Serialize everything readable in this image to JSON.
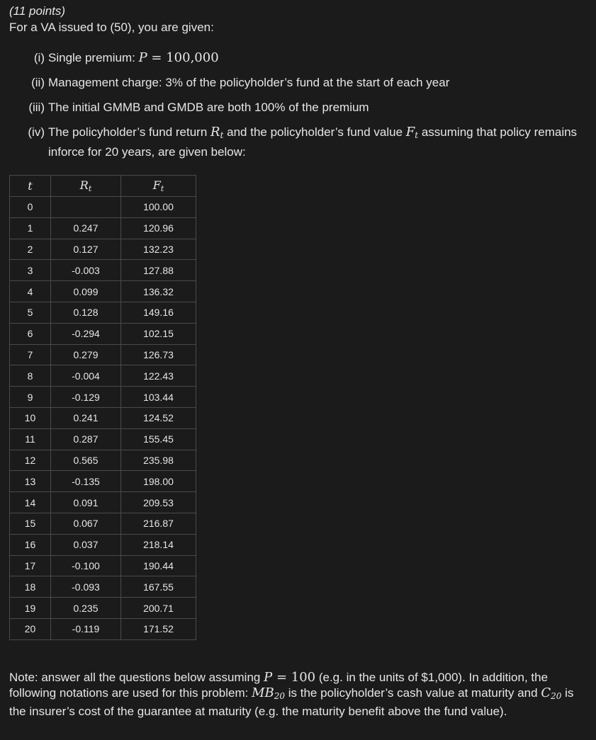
{
  "header": {
    "points": "(11 points)",
    "intro": "For a VA issued to (50), you are given:"
  },
  "givens": [
    {
      "num": "(i)",
      "text": "Single premium: ",
      "math_var": "P",
      "math_rest": " = 100,000"
    },
    {
      "num": "(ii)",
      "text": "Management charge: 3% of the policyholder’s fund at the start of each year"
    },
    {
      "num": "(iii)",
      "text": "The initial GMMB and GMDB are both 100% of the premium"
    },
    {
      "num": "(iv)",
      "text_a": "The policyholder’s fund return ",
      "var_a": "R",
      "sub_a": "t",
      "text_b": " and the policyholder’s fund value ",
      "var_b": "F",
      "sub_b": "t",
      "text_c": " assuming that policy remains inforce for 20 years, are given below:"
    }
  ],
  "table": {
    "headers": [
      {
        "var": "t",
        "sub": ""
      },
      {
        "var": "R",
        "sub": "t"
      },
      {
        "var": "F",
        "sub": "t"
      }
    ],
    "rows": [
      [
        "0",
        "",
        "100.00"
      ],
      [
        "1",
        "0.247",
        "120.96"
      ],
      [
        "2",
        "0.127",
        "132.23"
      ],
      [
        "3",
        "-0.003",
        "127.88"
      ],
      [
        "4",
        "0.099",
        "136.32"
      ],
      [
        "5",
        "0.128",
        "149.16"
      ],
      [
        "6",
        "-0.294",
        "102.15"
      ],
      [
        "7",
        "0.279",
        "126.73"
      ],
      [
        "8",
        "-0.004",
        "122.43"
      ],
      [
        "9",
        "-0.129",
        "103.44"
      ],
      [
        "10",
        "0.241",
        "124.52"
      ],
      [
        "11",
        "0.287",
        "155.45"
      ],
      [
        "12",
        "0.565",
        "235.98"
      ],
      [
        "13",
        "-0.135",
        "198.00"
      ],
      [
        "14",
        "0.091",
        "209.53"
      ],
      [
        "15",
        "0.067",
        "216.87"
      ],
      [
        "16",
        "0.037",
        "218.14"
      ],
      [
        "17",
        "-0.100",
        "190.44"
      ],
      [
        "18",
        "-0.093",
        "167.55"
      ],
      [
        "19",
        "0.235",
        "200.71"
      ],
      [
        "20",
        "-0.119",
        "171.52"
      ]
    ]
  },
  "note": {
    "p1": "Note: answer all the questions below assuming ",
    "m1_var": "P",
    "m1_rest": " = 100",
    "p2": " (e.g. in the units of $1,000). In addition, the following notations are used for this problem: ",
    "m2_var": "MB",
    "m2_sub": "20",
    "p3": " is the policyholder’s cash value at maturity and ",
    "m3_var": "C",
    "m3_sub": "20",
    "p4": " is the insurer’s cost of the guarantee at maturity (e.g. the maturity benefit above the fund value)."
  }
}
